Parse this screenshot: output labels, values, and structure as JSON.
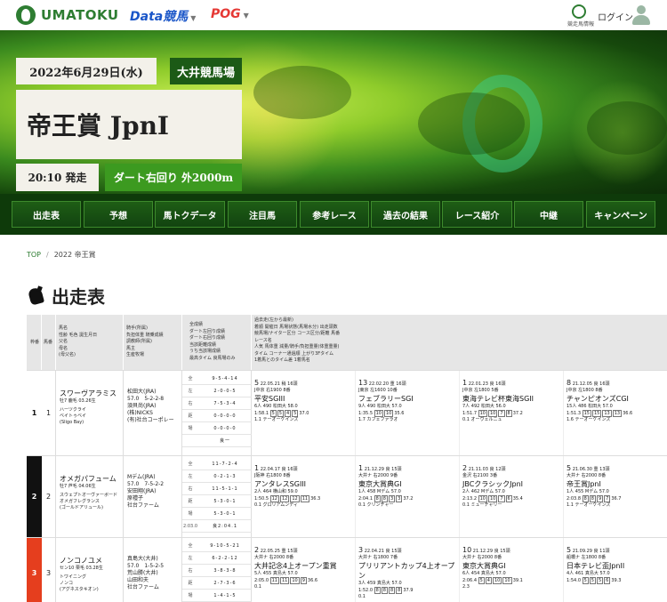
{
  "header": {
    "logo": "UMATOKU",
    "brand_data": "Data競馬",
    "brand_pog": "POG",
    "tv_label": "競走馬情報",
    "login": "ログイン"
  },
  "hero": {
    "date": "2022年6月29日(水)",
    "venue": "大井競馬場",
    "title": "帝王賞 JpnI",
    "start_time": "20:10 発走",
    "course": "ダート右回り 外2000m"
  },
  "nav": [
    "出走表",
    "予想",
    "馬トクデータ",
    "注目馬",
    "参考レース",
    "過去の結果",
    "レース紹介",
    "中継",
    "キャンペーン"
  ],
  "breadcrumb": {
    "top": "TOP",
    "current": "2022 帝王賞"
  },
  "section_title": "出走表",
  "thead": {
    "waku": "枠番",
    "umaban": "馬番",
    "horse": "馬名\n性齢 毛色 誕生月日\n父名\n母名\n(母父名)",
    "jockey": "騎手(所属)\n負担体重 騎乗成績\n調教師(所属)\n馬主\n生産牧場",
    "stats": "全成績\nダート左回り成績\nダート右回り成績\n当該距離成績\nうち当該場成績\n最高タイム 良馬場のみ",
    "past": "過去走(左から最新)\n着順 開催日 馬場状態(馬場水分) 出走頭数\n競馬場/ナイター区分 コース区分/距離 馬番\nレース名\n人気 馬体重 減量/騎手/負担重量(体重重量)\nタイム コーナー通過順 上がり3Fタイム\n1着馬とのタイム差 1着馬名"
  },
  "rows": [
    {
      "waku": "1",
      "umaban": "1",
      "horse_name": "スワーヴアラミス",
      "horse_info": "牡7 鹿毛 03.26生",
      "sire": "ハーツクライ",
      "dam": "ベイトゥベイ",
      "damsire": "(Sligo Bay)",
      "jockey": "松田大(JRA)",
      "weight": "57.0　5-2-2-8",
      "trainer": "須貝尚(JRA)",
      "owner": "(株)NICKS",
      "breeder": "(有)社台コーポレー",
      "stats": [
        [
          "全",
          "9-5-4-14"
        ],
        [
          "左",
          "2-0-0-5"
        ],
        [
          "右",
          "7-5-3-4"
        ],
        [
          "距",
          "0-0-0-0"
        ],
        [
          "場",
          "0-0-0-0"
        ],
        [
          "",
          "良一"
        ]
      ],
      "past": [
        {
          "pos": "5",
          "date": "22.05.21 稍 16頭",
          "course": "J中京 右1900 8番",
          "race": "平安SGIII",
          "l1": "6人 490 松田大 58.0",
          "l2": "1:58.1",
          "boxes": [
            "5",
            "5",
            "4",
            "5"
          ],
          "l3": "37.0",
          "l4": "1.1 テーオーケインズ"
        },
        {
          "pos": "13",
          "date": "22.02.20 重 16頭",
          "course": "J東京 左1600 10番",
          "race": "フェブラリーSGI",
          "l1": "9人 490 松田大 57.0",
          "l2": "1:35.5",
          "boxes": [
            "10",
            "10"
          ],
          "l3": "35.6",
          "l4": "1.7 カフェファラオ"
        },
        {
          "pos": "1",
          "date": "22.01.23 良 16頭",
          "course": "J中京 左1800 5番",
          "race": "東海テレビ杯東海SGII",
          "l1": "7人 492 松田大 56.0",
          "l2": "1:51.7",
          "boxes": [
            "10",
            "10",
            "7",
            "8"
          ],
          "l3": "37.2",
          "l4": "0.1 オーヴェルニュ"
        },
        {
          "pos": "8",
          "date": "21.12.05 良 16頭",
          "course": "J中京 左1800 8番",
          "race": "チャンピオンズCGI",
          "l1": "15人 486 松田大 57.0",
          "l2": "1:51.3",
          "boxes": [
            "15",
            "15",
            "13",
            "13"
          ],
          "l3": "36.6",
          "l4": "1.6 テーオーケインズ"
        }
      ]
    },
    {
      "waku": "2",
      "umaban": "2",
      "horse_name": "オメガパフューム",
      "horse_info": "牡7 芦毛 04.06生",
      "sire": "スウェプトオーヴァーボード",
      "dam": "オメガフレグランス",
      "damsire": "(ゴールドアリュール)",
      "jockey": "Mデム(JRA)",
      "weight": "57.0　7-5-2-2",
      "trainer": "安田翔(JRA)",
      "owner": "原禮子",
      "breeder": "社台ファーム",
      "stats": [
        [
          "全",
          "11-7-2-4"
        ],
        [
          "左",
          "0-2-1-3"
        ],
        [
          "右",
          "11-5-1-1"
        ],
        [
          "距",
          "5-3-0-1"
        ],
        [
          "場",
          "5-3-0-1"
        ],
        [
          "2:03.0",
          "良2:04.1"
        ]
      ],
      "past": [
        {
          "pos": "1",
          "date": "22.04.17 良 16頭",
          "course": "J阪神 右1800 8番",
          "race": "アンタレスSGIII",
          "l1": "2人 464 横山和 59.0",
          "l2": "1:50.5",
          "boxes": [
            "12",
            "12",
            "12",
            "11"
          ],
          "l3": "36.3",
          "l4": "0.1 グロリアムンディ"
        },
        {
          "pos": "1",
          "date": "21.12.29 良 15頭",
          "course": "大井ナ 右2000 9番",
          "race": "東京大賞典GI",
          "l1": "1人 458 Mデム 57.0",
          "l2": "2:04.1",
          "boxes": [
            "8",
            "8",
            "3",
            "3"
          ],
          "l3": "37.2",
          "l4": "0.1 クリンチャー"
        },
        {
          "pos": "2",
          "date": "21.11.03 良 12頭",
          "course": "金沢 右2100 3番",
          "race": "JBCクラシックJpnI",
          "l1": "2人 462 Mデム 57.0",
          "l2": "2:13.2",
          "boxes": [
            "10",
            "10",
            "7",
            "6"
          ],
          "l3": "35.4",
          "l4": "0.1 ミューチャリー"
        },
        {
          "pos": "5",
          "date": "21.06.30 重 13頭",
          "course": "大井ナ 右2000 8番",
          "race": "帝王賞JpnI",
          "l1": "1人 455 Mデム 57.0",
          "l2": "2:03.8",
          "boxes": [
            "8",
            "8",
            "9",
            "7"
          ],
          "l3": "36.7",
          "l4": "1.1 テーオーケインズ"
        }
      ]
    },
    {
      "waku": "3",
      "umaban": "3",
      "horse_name": "ノンコノユメ",
      "horse_info": "セン10 栗毛 03.28生",
      "sire": "トワイニング",
      "dam": "ノンコ",
      "damsire": "(アグネスタキオン)",
      "jockey": "真島大(大井)",
      "weight": "57.0　1-5-2-5",
      "trainer": "荒山勝(大井)",
      "owner": "山田和夫",
      "breeder": "社台ファーム",
      "stats": [
        [
          "全",
          "9-10-5-21"
        ],
        [
          "左",
          "6-2-2-12"
        ],
        [
          "右",
          "3-8-3-8"
        ],
        [
          "距",
          "2-7-3-6"
        ],
        [
          "場",
          "1-4-1-5"
        ],
        [
          "",
          ""
        ]
      ],
      "past": [
        {
          "pos": "2",
          "date": "22.05.25 重 15頭",
          "course": "大井ナ 右2000 8番",
          "race": "大井記念4上オープン重賞",
          "l1": "5人 455 真島大 57.0",
          "l2": "2:05.0",
          "boxes": [
            "11",
            "11",
            "10",
            "9"
          ],
          "l3": "36.6",
          "l4": "0.1"
        },
        {
          "pos": "3",
          "date": "22.04.21 良 15頭",
          "course": "大井ナ 右1800 7番",
          "race": "プリリアントカップ4上オープン",
          "l1": "3人 459 真島大 57.0",
          "l2": "1:52.0",
          "boxes": [
            "8",
            "8",
            "8",
            "8"
          ],
          "l3": "37.9",
          "l4": "0.1"
        },
        {
          "pos": "10",
          "date": "21.12.29 良 15頭",
          "course": "大井ナ 右2000 8番",
          "race": "東京大賞典GI",
          "l1": "6人 454 真島大 57.0",
          "l2": "2:06.4",
          "boxes": [
            "5",
            "4",
            "10",
            "10"
          ],
          "l3": "39.1",
          "l4": "2.3"
        },
        {
          "pos": "5",
          "date": "21.09.29 良 11頭",
          "course": "船橋ナ 左1800 8番",
          "race": "日本テレビ盃JpnII",
          "l1": "4人 461 真島大 57.0",
          "l2": "1:54.0",
          "boxes": [
            "5",
            "5",
            "5",
            "6"
          ],
          "l3": "39.3",
          "l4": ""
        }
      ]
    }
  ],
  "colors": {
    "waku1": "#ffffff",
    "waku2": "#111111",
    "waku3": "#e53e1e",
    "accent": "#2e7d32"
  }
}
